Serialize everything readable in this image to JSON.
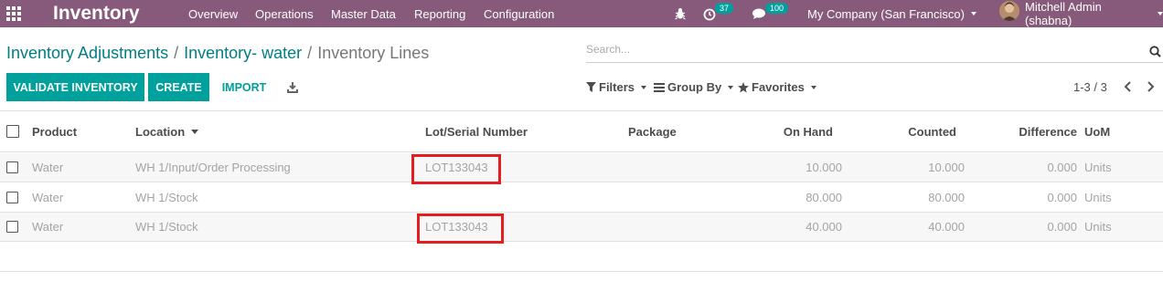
{
  "navbar": {
    "app_name": "Inventory",
    "menu": [
      "Overview",
      "Operations",
      "Master Data",
      "Reporting",
      "Configuration"
    ],
    "activity_count": "37",
    "message_count": "100",
    "company": "My Company (San Francisco)",
    "user": "Mitchell Admin (shabna)",
    "bg_color": "#875a7b",
    "badge_color": "#00a09d"
  },
  "breadcrumb": {
    "items": [
      "Inventory Adjustments",
      "Inventory- water"
    ],
    "current": "Inventory Lines",
    "separator": "/"
  },
  "search": {
    "placeholder": "Search..."
  },
  "buttons": {
    "validate": "Validate Inventory",
    "create": "Create",
    "import": "Import"
  },
  "filters": {
    "filters_label": "Filters",
    "groupby_label": "Group By",
    "favorites_label": "Favorites"
  },
  "pager": {
    "value": "1-3 / 3"
  },
  "table": {
    "columns": {
      "product": "Product",
      "location": "Location",
      "lot": "Lot/Serial Number",
      "package": "Package",
      "on_hand": "On Hand",
      "counted": "Counted",
      "difference": "Difference",
      "uom": "UoM"
    },
    "rows": [
      {
        "product": "Water",
        "location": "WH 1/Input/Order Processing",
        "lot": "LOT133043",
        "package": "",
        "on_hand": "10.000",
        "counted": "10.000",
        "difference": "0.000",
        "uom": "Units"
      },
      {
        "product": "Water",
        "location": "WH 1/Stock",
        "lot": "",
        "package": "",
        "on_hand": "80.000",
        "counted": "80.000",
        "difference": "0.000",
        "uom": "Units"
      },
      {
        "product": "Water",
        "location": "WH 1/Stock",
        "lot": "LOT133043",
        "package": "",
        "on_hand": "40.000",
        "counted": "40.000",
        "difference": "0.000",
        "uom": "Units"
      }
    ]
  },
  "accent_color": "#00a09d",
  "highlight_color": "#e41e1e"
}
